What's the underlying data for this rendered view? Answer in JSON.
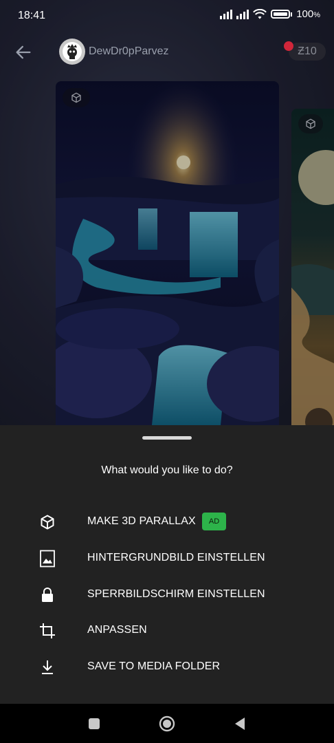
{
  "status_bar": {
    "time": "18:41",
    "battery": "100",
    "battery_unit": "%"
  },
  "header": {
    "username": "DewDr0pParvez",
    "coins": "Ƶ10"
  },
  "sheet": {
    "title": "What would you like to do?",
    "options": [
      {
        "label": "MAKE 3D PARALLAX",
        "icon": "cube-icon",
        "badge": "AD"
      },
      {
        "label": "HINTERGRUNDBILD EINSTELLEN",
        "icon": "image-icon"
      },
      {
        "label": "SPERRBILDSCHIRM EINSTELLEN",
        "icon": "lock-icon"
      },
      {
        "label": "ANPASSEN",
        "icon": "crop-icon"
      },
      {
        "label": "SAVE TO MEDIA FOLDER",
        "icon": "download-icon"
      }
    ]
  },
  "colors": {
    "sheet_bg": "#222222",
    "ad_badge": "#2db34a",
    "notification_dot": "#d0263a"
  }
}
